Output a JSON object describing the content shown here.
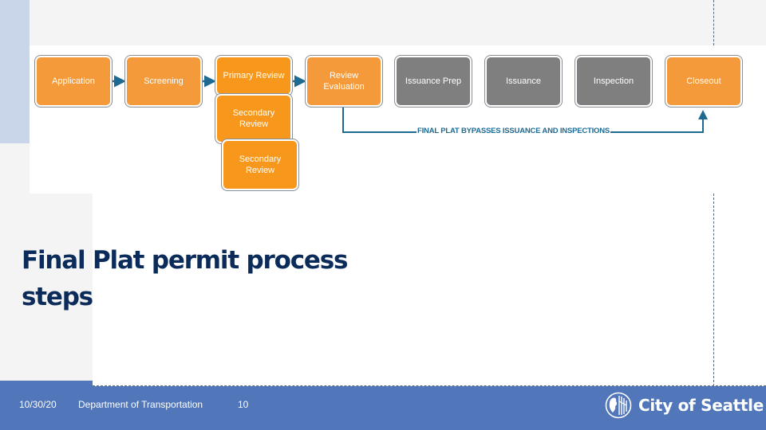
{
  "slide": {
    "title": "Final Plat permit process steps",
    "colors": {
      "step_active": "#f59a3a",
      "step_inactive": "#7f7f7f",
      "connector": "#1e6a93",
      "title": "#0b2b5b",
      "footer": "#5176b9"
    }
  },
  "diagram": {
    "steps": [
      {
        "id": "application",
        "label": "Application",
        "state": "active"
      },
      {
        "id": "screening",
        "label": "Screening",
        "state": "active"
      },
      {
        "id": "primary-review",
        "label": "Primary Review",
        "state": "active"
      },
      {
        "id": "review-evaluation",
        "label": "Review\nEvaluation",
        "state": "active"
      },
      {
        "id": "issuance-prep",
        "label": "Issuance Prep",
        "state": "inactive"
      },
      {
        "id": "issuance",
        "label": "Issuance",
        "state": "inactive"
      },
      {
        "id": "inspection",
        "label": "Inspection",
        "state": "inactive"
      },
      {
        "id": "closeout",
        "label": "Closeout",
        "state": "active"
      }
    ],
    "sub_steps": [
      {
        "id": "secondary-review-1",
        "label": "Secondary\nReview",
        "parent": "primary-review"
      },
      {
        "id": "secondary-review-2",
        "label": "Secondary\nReview",
        "parent": "primary-review"
      }
    ],
    "connections": [
      {
        "from": "application",
        "to": "screening"
      },
      {
        "from": "screening",
        "to": "primary-review"
      },
      {
        "from": "primary-review",
        "to": "review-evaluation"
      },
      {
        "from": "review-evaluation",
        "to": "closeout",
        "label": "FINAL PLAT BYPASSES ISSUANCE AND INSPECTIONS"
      }
    ]
  },
  "footer": {
    "date": "10/30/20",
    "department": "Department of Transportation",
    "page_number": "10",
    "logo_text": "City of Seattle"
  }
}
